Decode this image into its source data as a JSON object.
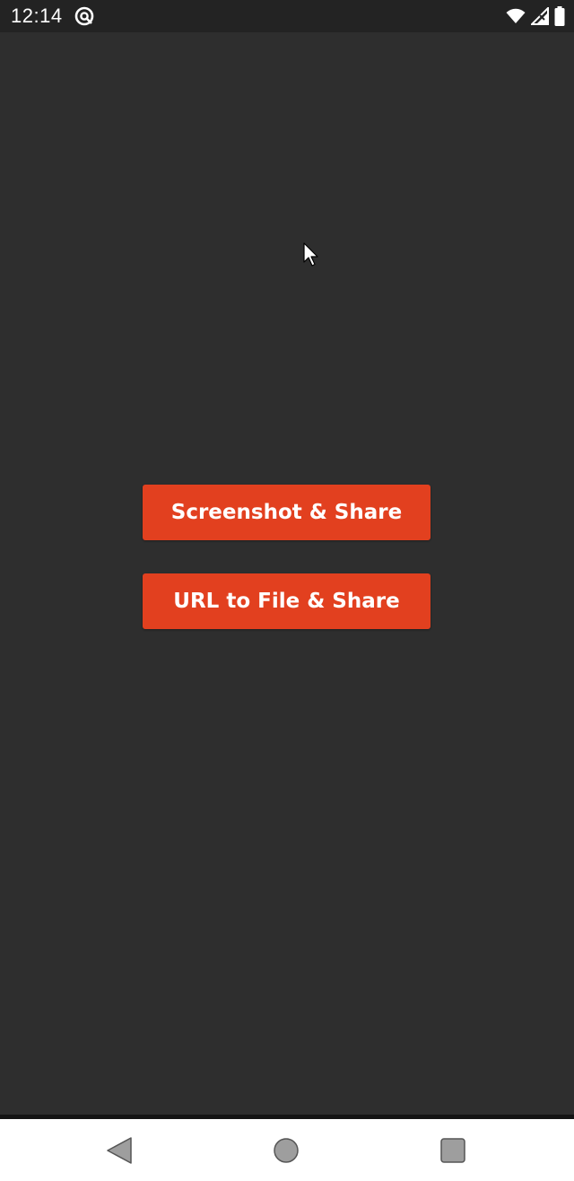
{
  "status_bar": {
    "time": "12:14",
    "app_icon": "at-sign-icon",
    "wifi_icon": "wifi-icon",
    "signal_icon": "cell-signal-icon",
    "battery_icon": "battery-icon"
  },
  "main": {
    "buttons": [
      {
        "label": "Screenshot & Share"
      },
      {
        "label": "URL to File & Share"
      }
    ]
  },
  "nav_bar": {
    "back_icon": "back-triangle-icon",
    "home_icon": "home-circle-icon",
    "recents_icon": "recents-square-icon"
  },
  "colors": {
    "background": "#2e2e2e",
    "status_bar": "#232323",
    "accent_button": "#e2401f",
    "button_text": "#ffffff",
    "nav_bar": "#ffffff"
  }
}
